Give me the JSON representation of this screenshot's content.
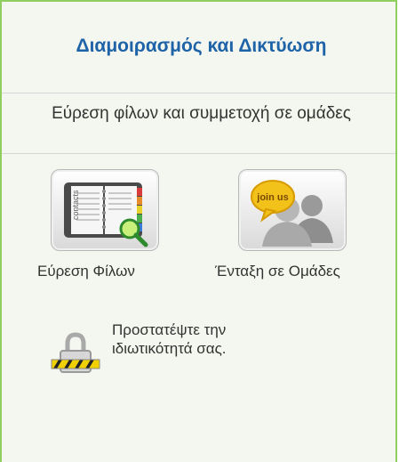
{
  "panel": {
    "title": "Διαμοιρασμός και Δικτύωση",
    "subtitle": "Εύρεση φίλων και συμμετοχή σε ομάδες",
    "find_friends_label": "Εύρεση Φίλων",
    "join_groups_label": "Ένταξη σε Ομάδες",
    "privacy_text": "Προστατέψτε την ιδιωτικότητά σας.",
    "contacts_book_text": "contacts",
    "join_bubble_text": "join us"
  },
  "colors": {
    "title": "#1e62a8",
    "border": "#8fcf60",
    "panel_bg": "#f4f7ef"
  },
  "icons": [
    "contacts-book-icon",
    "magnifier-icon",
    "join-us-group-icon",
    "padlock-icon"
  ]
}
